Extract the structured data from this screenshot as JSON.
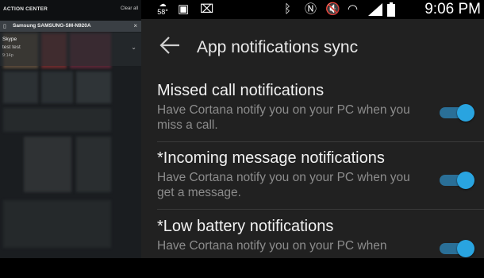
{
  "action_center": {
    "title": "ACTION CENTER",
    "clear_all": "Clear all",
    "group": {
      "icon": "phone-icon",
      "label": "Samsung SAMSUNG-SM-N920A"
    },
    "notification": {
      "app": "Skype",
      "message": "test test",
      "time": "9:14p"
    }
  },
  "status_bar": {
    "temperature": "58°",
    "time": "9:06 PM",
    "icons": [
      "weather-icon",
      "screenshot-icon",
      "briefcase-icon",
      "bluetooth-icon",
      "nfc-icon",
      "mute-icon",
      "wifi-icon",
      "signal-icon",
      "battery-icon"
    ]
  },
  "app_bar": {
    "title": "App notifications sync"
  },
  "settings": [
    {
      "title": "Missed call notifications",
      "description": "Have Cortana notify you on your PC when you miss a call.",
      "enabled": true
    },
    {
      "title": "*Incoming message notifications",
      "description": "Have Cortana notify you on your PC when you get a message.",
      "enabled": true
    },
    {
      "title": "*Low battery notifications",
      "description": "Have Cortana notify you on your PC when",
      "enabled": true
    }
  ],
  "colors": {
    "accent": "#29a4e0",
    "track": "#2a6f97",
    "background": "#212121"
  }
}
